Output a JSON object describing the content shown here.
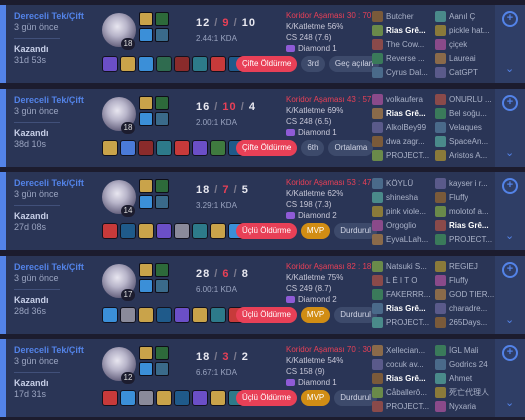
{
  "matches": [
    {
      "queue": "Dereceli Tek/Çift",
      "ago": "3 gün önce",
      "result": "Kazandı",
      "duration": "31d 53s",
      "level": "18",
      "kills": "12",
      "deaths": "9",
      "assists": "10",
      "kda": "2.44:1 KDA",
      "stat_phase": "Koridor Aşaması 30 : 70",
      "stat_kp": "K/Katletme 56%",
      "stat_cs": "CS 248 (7.6)",
      "stat_rank": "Diamond 1",
      "badges": [
        "Çifte Öldürme",
        "3rd",
        "Geç açılan"
      ],
      "team_blue": [
        "Butcher",
        "Rias Grê...",
        "The Cow...",
        "Reverse ...",
        "Cyrus Dal..."
      ],
      "team_red": [
        "Aanıl Ç",
        "pickle hat...",
        "çiçek",
        "Laureai",
        "CatGPT"
      ]
    },
    {
      "queue": "Dereceli Tek/Çift",
      "ago": "3 gün önce",
      "result": "Kazandı",
      "duration": "38d 10s",
      "level": "18",
      "kills": "16",
      "deaths": "10",
      "assists": "4",
      "kda": "2.00:1 KDA",
      "stat_phase": "Koridor Aşaması 43 : 57",
      "stat_kp": "K/Katletme 69%",
      "stat_cs": "CS 248 (6.5)",
      "stat_rank": "Diamond 1",
      "badges": [
        "Çifte Öldürme",
        "6th",
        "Ortalama"
      ],
      "team_blue": [
        "volkaufera",
        "Rias Grê...",
        "AlkolBey99",
        "dwa zagr...",
        "PROJECT..."
      ],
      "team_red": [
        "ONURLU ...",
        "Bel soğu...",
        "Velaques",
        "SpaceAn...",
        "Aristos A..."
      ]
    },
    {
      "queue": "Dereceli Tek/Çift",
      "ago": "3 gün önce",
      "result": "Kazandı",
      "duration": "27d 08s",
      "level": "14",
      "kills": "18",
      "deaths": "7",
      "assists": "5",
      "kda": "3.29:1 KDA",
      "stat_phase": "Koridor Aşaması 53 : 47",
      "stat_kp": "K/Katletme 62%",
      "stat_cs": "CS 198 (7.3)",
      "stat_rank": "Diamond 2",
      "badges": [
        "Üçlü Öldürme",
        "MVP",
        "Durdurul"
      ],
      "team_blue": [
        "KÖYLÜ",
        "shinesha",
        "pink viole...",
        "Orgoglio",
        "EyvaLLah..."
      ],
      "team_red": [
        "kayser i r...",
        "Fluffy",
        "molotof a...",
        "Rias Grê...",
        "PROJECT..."
      ]
    },
    {
      "queue": "Dereceli Tek/Çift",
      "ago": "3 gün önce",
      "result": "Kazandı",
      "duration": "28d 36s",
      "level": "17",
      "kills": "28",
      "deaths": "6",
      "assists": "8",
      "kda": "6.00:1 KDA",
      "stat_phase": "Koridor Aşaması 82 : 18",
      "stat_kp": "K/Katletme 75%",
      "stat_cs": "CS 249 (8.7)",
      "stat_rank": "Diamond 2",
      "badges": [
        "Üçlü Öldürme",
        "MVP",
        "Durdurul"
      ],
      "team_blue": [
        "Natsuki S...",
        "L É I T O",
        "FAKERRR...",
        "Rias Grê...",
        "PROJECT..."
      ],
      "team_red": [
        "REGIEJ",
        "Fluffy",
        "GOD TIER...",
        "charadre...",
        "265Days..."
      ]
    },
    {
      "queue": "Dereceli Tek/Çift",
      "ago": "3 gün önce",
      "result": "Kazandı",
      "duration": "17d 31s",
      "level": "12",
      "kills": "18",
      "deaths": "3",
      "assists": "2",
      "kda": "6.67:1 KDA",
      "stat_phase": "Koridor Aşaması 70 : 30",
      "stat_kp": "K/Katletme 54%",
      "stat_cs": "CS 158 (9)",
      "stat_rank": "Diamond 1",
      "badges": [
        "Üçlü Öldürme",
        "MVP",
        "Durdurul"
      ],
      "team_blue": [
        "Xellecian...",
        "cocuk av...",
        "Rias Grê...",
        "Cåballerô...",
        "PROJECT..."
      ],
      "team_red": [
        "İGL Mali",
        "Godrics 24",
        "Ahmet",
        "死亡代理人",
        "Nyxaria"
      ]
    }
  ],
  "icons": {
    "expand": "chevron-down-icon",
    "add": "add-circle-icon",
    "rank": "diamond-rank-icon"
  },
  "colors": {
    "win_accent": "#5383e8",
    "row_bg": "#2a3556",
    "death": "#e84057",
    "mvp": "#d18d14"
  }
}
